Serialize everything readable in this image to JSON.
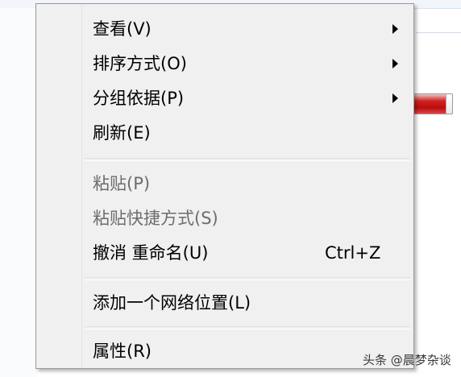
{
  "context_menu": {
    "items": [
      {
        "label": "查看(V)",
        "has_submenu": true
      },
      {
        "label": "排序方式(O)",
        "has_submenu": true
      },
      {
        "label": "分组依据(P)",
        "has_submenu": true
      },
      {
        "label": "刷新(E)"
      },
      {
        "label": "粘贴(P)",
        "disabled": true
      },
      {
        "label": "粘贴快捷方式(S)",
        "disabled": true
      },
      {
        "label": "撤消 重命名(U)",
        "shortcut": "Ctrl+Z"
      },
      {
        "label": "添加一个网络位置(L)"
      },
      {
        "label": "属性(R)"
      }
    ]
  },
  "background": {
    "progress_color": "#c81818",
    "progress_fraction": 0.85
  },
  "watermark": {
    "text": "头条 @晨梦杂谈"
  }
}
